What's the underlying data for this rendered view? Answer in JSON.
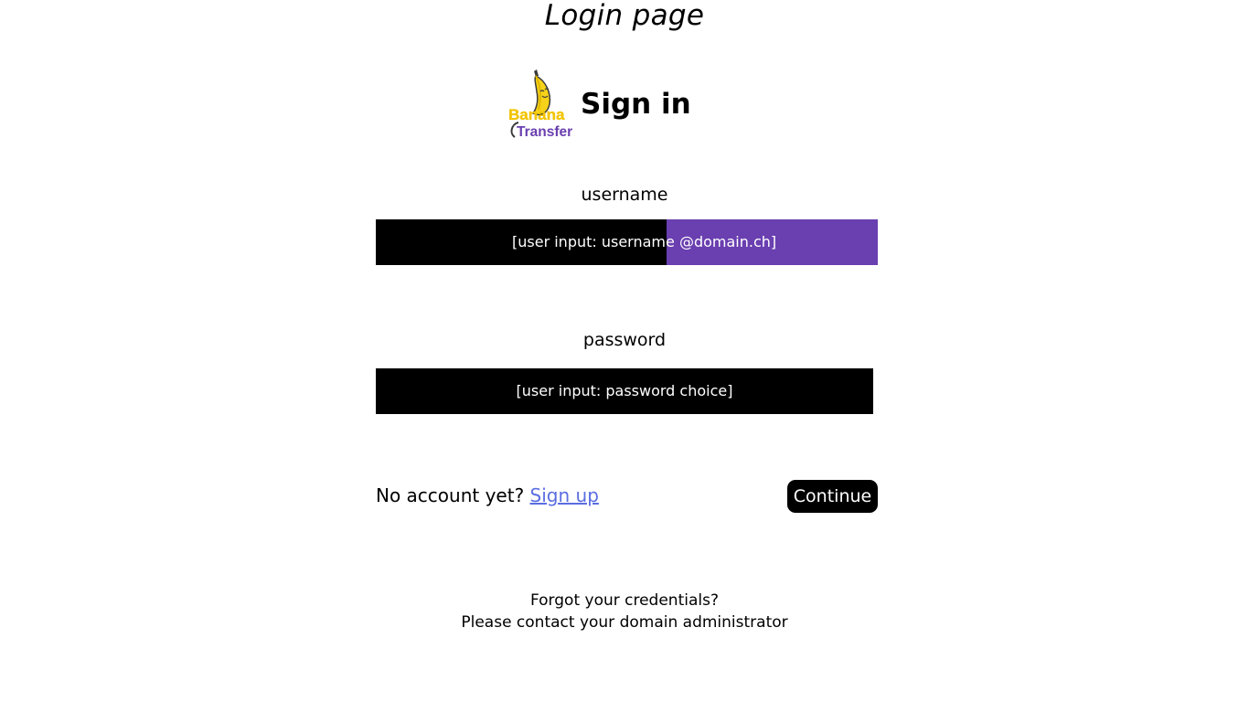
{
  "page": {
    "title": "Login page"
  },
  "logo": {
    "icon": "banana-icon",
    "text_line1": "Banana",
    "text_line2": "Transfer",
    "colors": {
      "banana": "#f6d21a",
      "banana_outline": "#3a3a3a",
      "text_line1": "#f2c400",
      "text_line2": "#6a3fb0"
    }
  },
  "heading": "Sign in",
  "username": {
    "label": "username",
    "value": "[user input: username @domain.ch]",
    "domain_highlight_color": "#6a3fb0"
  },
  "password": {
    "label": "password",
    "value": "[user input: password choice]"
  },
  "account": {
    "prompt": "No account yet?",
    "signup_label": "Sign up",
    "link_color": "#5b6ee1"
  },
  "continue_label": "Continue",
  "forgot": {
    "line1": "Forgot your credentials?",
    "line2": "Please contact your domain administrator"
  }
}
